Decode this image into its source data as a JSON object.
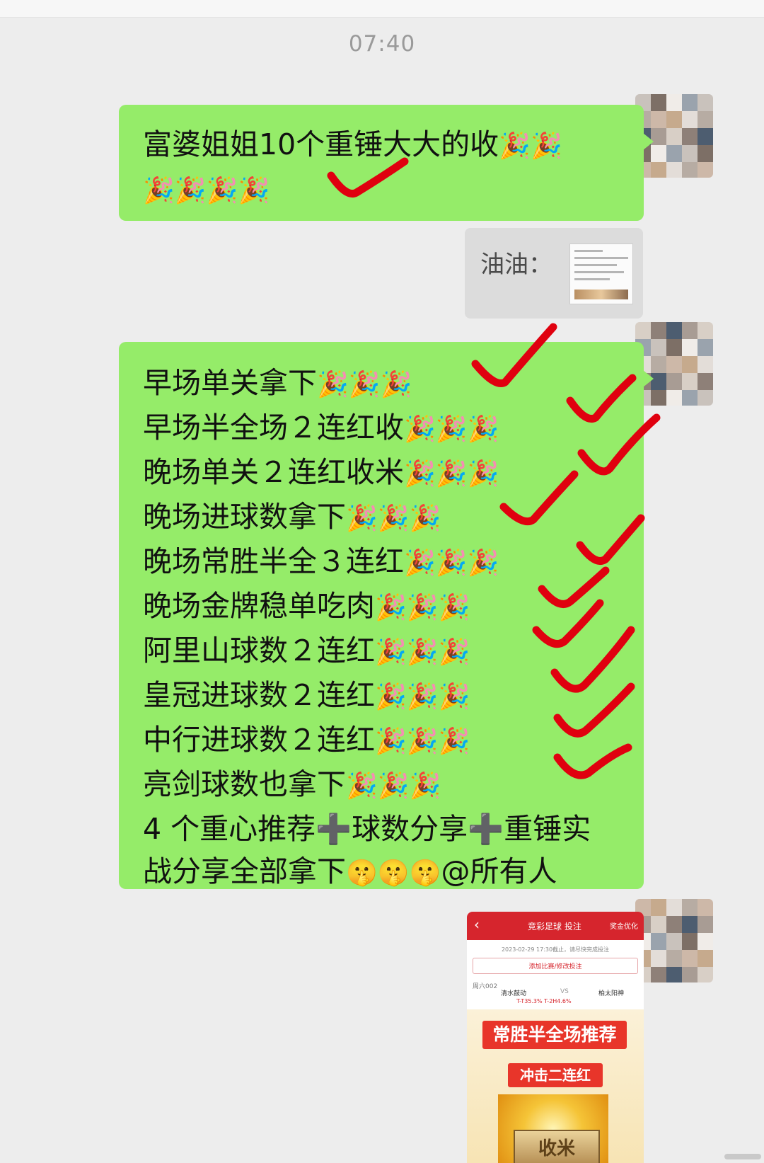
{
  "header": {
    "time": "07:40"
  },
  "messages": {
    "msg1": {
      "lines": [
        {
          "text": "富婆姐姐10个重锤大大的收",
          "emoji": "🎉🎉"
        },
        {
          "text": "",
          "emoji": "🎉🎉🎉🎉"
        }
      ]
    },
    "quote": {
      "name": "油油："
    },
    "msg2": {
      "lines": [
        {
          "text": "早场单关拿下",
          "emoji": "🎉🎉🎉"
        },
        {
          "text": "早场半全场２连红收",
          "emoji": "🎉🎉🎉"
        },
        {
          "text": "晚场单关２连红收米",
          "emoji": "🎉🎉🎉"
        },
        {
          "text": "晚场进球数拿下",
          "emoji": "🎉🎉🎉"
        },
        {
          "text": "晚场常胜半全３连红",
          "emoji": "🎉🎉🎉"
        },
        {
          "text": "晚场金牌稳单吃肉",
          "emoji": "🎉🎉🎉"
        },
        {
          "text": "阿里山球数２连红",
          "emoji": "🎉🎉🎉"
        },
        {
          "text": "皇冠进球数２连红",
          "emoji": "🎉🎉🎉"
        },
        {
          "text": "中行进球数２连红",
          "emoji": "🎉🎉🎉"
        },
        {
          "text": "亮剑球数也拿下",
          "emoji": "🎉🎉🎉"
        },
        {
          "text": "4 个重心推荐➕球数分享➕重锤实",
          "emoji": ""
        },
        {
          "text": "战分享全部拿下",
          "emoji": "🤫🤫🤫",
          "tail": "@所有人"
        }
      ]
    },
    "image_card": {
      "header": "竞彩足球 投注",
      "header_right": "奖金优化",
      "back": "‹",
      "subline": "2023-02-29 17:30截止，请尽快完成投注",
      "button": "添加比赛/修改投注",
      "match_code": "周六002",
      "home": "清水鼓动",
      "vs": "VS",
      "away": "柏太阳神",
      "odds": "T-T35.3% T-2H4.6%",
      "promo_title": "常胜半全场推荐",
      "promo_sub": "冲击二连红",
      "plate": "收米"
    }
  },
  "colors": {
    "bubble_green": "#95ec69",
    "background": "#ededed",
    "check_red": "#e0000f"
  }
}
